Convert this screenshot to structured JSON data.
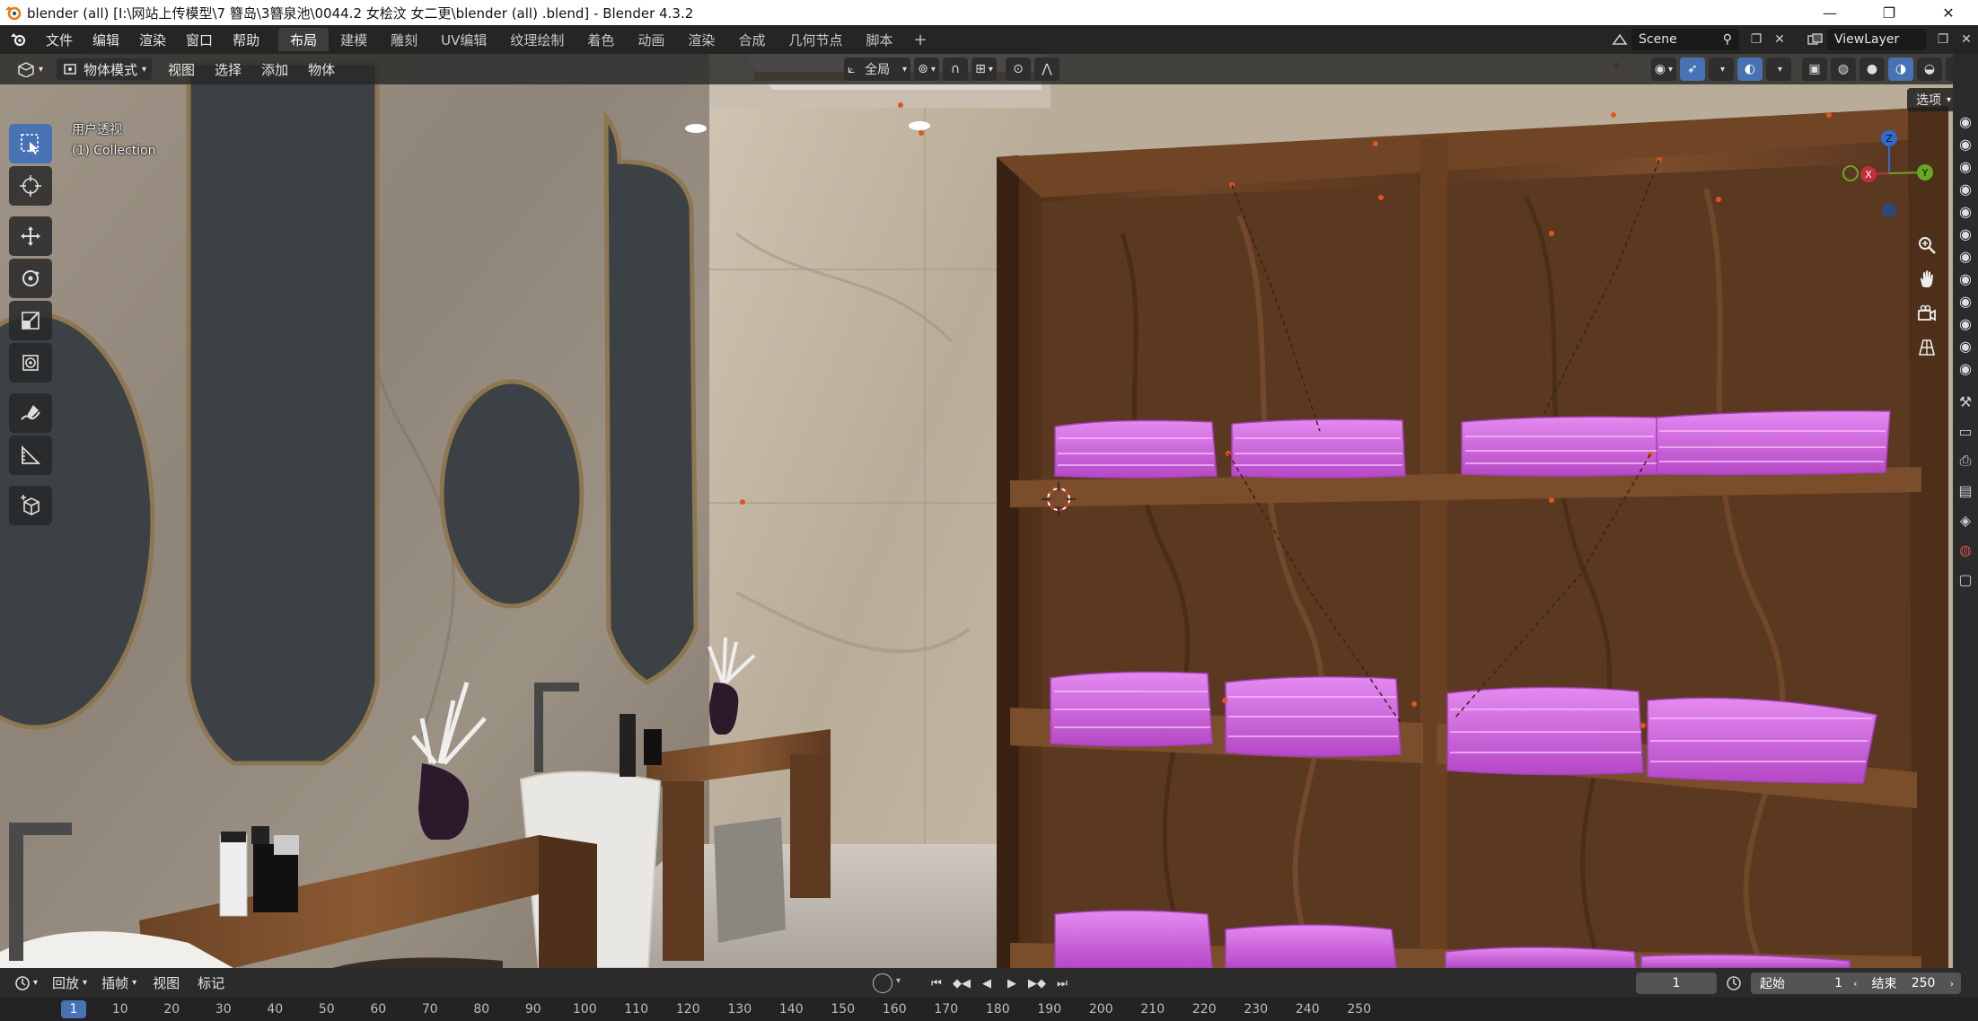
{
  "window": {
    "title": "blender (all)   [I:\\网站上传模型\\7 簪岛\\3簪泉池\\0044.2 女桧汶 女二更\\blender (all)  .blend] - Blender 4.3.2",
    "minimize": "—",
    "maximize": "❐",
    "close": "✕"
  },
  "menu": {
    "items": [
      "文件",
      "编辑",
      "渲染",
      "窗口",
      "帮助"
    ]
  },
  "workspaces": {
    "tabs": [
      "布局",
      "建模",
      "雕刻",
      "UV编辑",
      "纹理绘制",
      "着色",
      "动画",
      "渲染",
      "合成",
      "几何节点",
      "脚本"
    ],
    "active_index": 0,
    "add": "+"
  },
  "scene": {
    "label": "Scene"
  },
  "view_layer": {
    "label": "ViewLayer"
  },
  "viewport_header": {
    "mode": "物体模式",
    "menus": [
      "视图",
      "选择",
      "添加",
      "物体"
    ],
    "orientation": "全局",
    "options": "选项"
  },
  "viewport": {
    "view_name": "用户透视",
    "collection": "(1) Collection"
  },
  "gizmo": {
    "x": "X",
    "y": "Y",
    "z": "Z"
  },
  "timeline": {
    "menus": [
      "回放",
      "插帧",
      "视图",
      "标记"
    ],
    "current_frame": "1",
    "start_label": "起始",
    "start_value": "1",
    "end_label": "结束",
    "end_value": "250",
    "ruler_current": "1",
    "ticks": [
      "10",
      "20",
      "30",
      "40",
      "50",
      "60",
      "70",
      "80",
      "90",
      "100",
      "110",
      "120",
      "130",
      "140",
      "150",
      "160",
      "170",
      "180",
      "190",
      "200",
      "210",
      "220",
      "230",
      "240",
      "250"
    ]
  },
  "colors": {
    "accent": "#4772b3",
    "towel": "#d25ee0",
    "wood": "#6b4224"
  }
}
